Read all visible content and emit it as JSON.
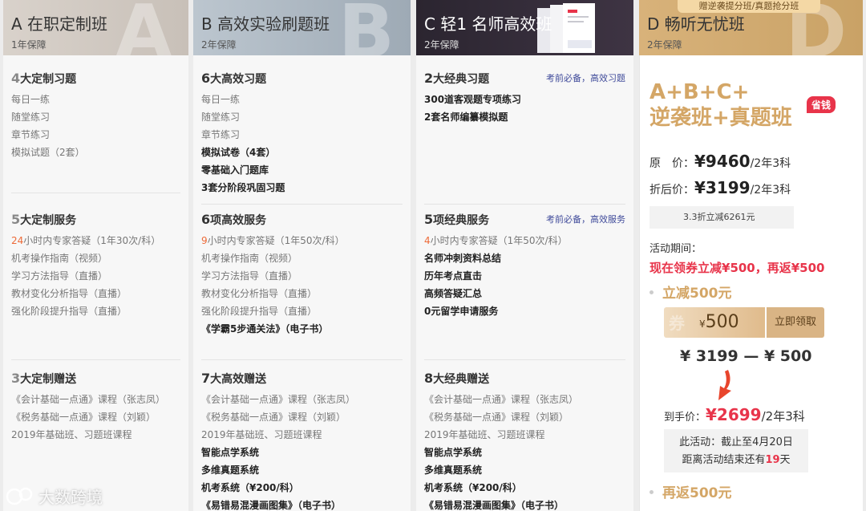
{
  "columns": {
    "a": {
      "letter": "A",
      "title": "A 在职定制班",
      "sub": "1年保障",
      "sec1": {
        "num": "4",
        "title": "大定制习题",
        "items": [
          "每日一练",
          "随堂练习",
          "章节练习",
          "模拟试题（2套）"
        ]
      },
      "sec2": {
        "num": "5",
        "title": "大定制服务",
        "items": [
          {
            "red": "24",
            "rest": "小时内专家答疑（1年30次/科）"
          },
          "机考操作指南（视频）",
          "学习方法指导（直播）",
          "教材变化分析指导（直播）",
          "强化阶段提升指导（直播）"
        ]
      },
      "sec3": {
        "num": "3",
        "title": "大定制赠送",
        "items": [
          "《会计基础一点通》课程（张志凤）",
          "《税务基础一点通》课程（刘颖）",
          "2019年基础班、习题班课程"
        ]
      }
    },
    "b": {
      "letter": "B",
      "title": "B 高效实验刷题班",
      "sub": "2年保障",
      "sec1": {
        "num": "6",
        "title": "大高效习题",
        "items": [
          "每日一练",
          "随堂练习",
          "章节练习",
          "模拟试卷（4套）",
          "零基础入门题库",
          "3套分阶段巩固习题"
        ]
      },
      "sec2": {
        "num": "6",
        "title": "项高效服务",
        "items": [
          {
            "red": "9",
            "rest": "小时内专家答疑（1年50次/科）"
          },
          "机考操作指南（视频）",
          "学习方法指导（直播）",
          "教材变化分析指导（直播）",
          "强化阶段提升指导（直播）",
          "《学霸5步通关法》（电子书）"
        ]
      },
      "sec3": {
        "num": "7",
        "title": "大高效赠送",
        "items": [
          "《会计基础一点通》课程（张志凤）",
          "《税务基础一点通》课程（刘颖）",
          "2019年基础班、习题班课程",
          "智能点学系统",
          "多维真题系统",
          "机考系统（¥200/科）",
          "《易错易混漫画图集》（电子书）"
        ]
      }
    },
    "c": {
      "title": "C 轻1 名师高效班",
      "sub": "2年保障",
      "sec1": {
        "num": "2",
        "title": "大经典习题",
        "side": "考前必备，高效习题",
        "items": [
          "300道客观题专项练习",
          "2套名师编纂模拟题"
        ]
      },
      "sec2": {
        "num": "5",
        "title": "项经典服务",
        "side": "考前必备，高效服务",
        "items": [
          {
            "red": "4",
            "rest": "小时内专家答疑（1年50次/科）"
          },
          "名师冲刺资料总结",
          "历年考点直击",
          "高频答疑汇总",
          "0元留学申请服务"
        ]
      },
      "sec3": {
        "num": "8",
        "title": "大经典赠送",
        "items": [
          "《会计基础一点通》课程（张志凤）",
          "《税务基础一点通》课程（刘颖）",
          "2019年基础班、习题班课程",
          "智能点学系统",
          "多维真题系统",
          "机考系统（¥200/科）",
          "《易错易混漫画图集》（电子书）"
        ]
      }
    },
    "d": {
      "letter": "D",
      "top_tag": "赠逆袭提分班/真题抢分班",
      "title": "D 畅听无忧班",
      "sub": "2年保障",
      "promo_line1": "A+B+C+",
      "promo_line2": "逆袭班+真题班",
      "save_badge": "省钱",
      "orig_label": "原　价：",
      "orig_price": "¥9460",
      "orig_unit": "/2年3科",
      "disc_label": "折后价：",
      "disc_price": "¥3199",
      "disc_unit": "/2年3科",
      "discount_note": "3.3折立减6261元",
      "act_label": "活动期间：",
      "act_slogan": "现在领券立减¥500，再返¥500",
      "bullet1": "立减500元",
      "coupon_cur": "¥",
      "coupon_val": "500",
      "coupon_btn": "立即领取",
      "calc": "¥ 3199 — ¥ 500",
      "final_label": "到手价：",
      "final_price": "¥2699",
      "final_unit": "/2年3科",
      "notice1": "此活动：截止至4月20日",
      "notice2_a": "距离活动结束还有",
      "notice2_days": "19",
      "notice2_b": "天",
      "bullet2": "再返500元"
    }
  },
  "watermark": "大数跨境",
  "colors": {
    "accent_gold": "#d4a666",
    "accent_red": "#e8344a",
    "link_blue": "#3f4a9a"
  }
}
